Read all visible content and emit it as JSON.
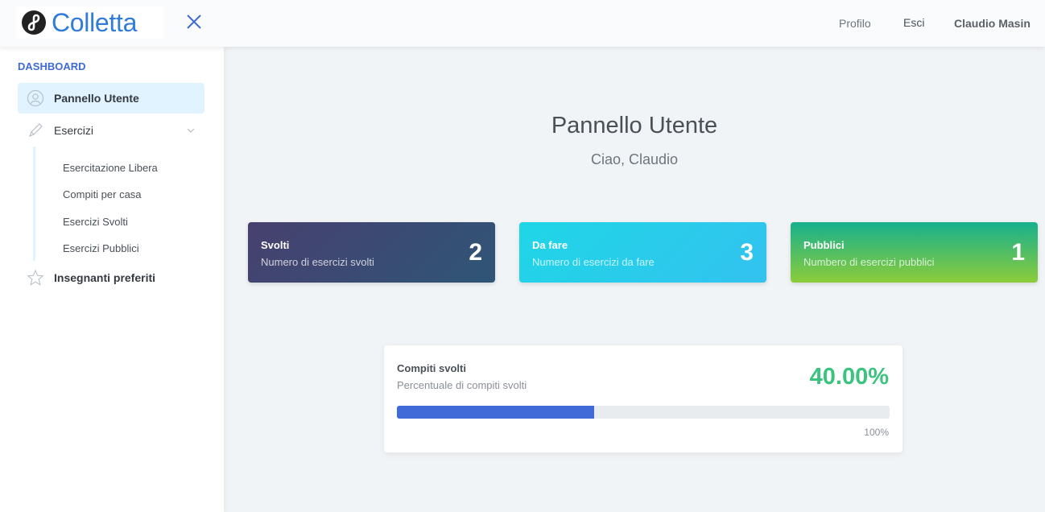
{
  "header": {
    "logo_text": "Colletta",
    "nav_profile": "Profilo",
    "nav_logout": "Esci",
    "user_name": "Claudio Masin"
  },
  "sidebar": {
    "heading": "DASHBOARD",
    "items": [
      {
        "label": "Pannello Utente",
        "icon": "user-circle-icon",
        "active": true
      },
      {
        "label": "Esercizi",
        "icon": "pencil-icon",
        "expanded": true
      },
      {
        "label": "Insegnanti preferiti",
        "icon": "star-icon"
      }
    ],
    "subitems": [
      {
        "label": "Esercitazione Libera"
      },
      {
        "label": "Compiti per casa"
      },
      {
        "label": "Esercizi Svolti"
      },
      {
        "label": "Esercizi Pubblici"
      }
    ]
  },
  "main": {
    "title": "Pannello Utente",
    "greeting": "Ciao, Claudio",
    "cards": [
      {
        "title": "Svolti",
        "subtitle": "Numero di esercizi svolti",
        "value": "2"
      },
      {
        "title": "Da fare",
        "subtitle": "Numero di esercizi da fare",
        "value": "3"
      },
      {
        "title": "Pubblici",
        "subtitle": "Numbero di esercizi pubblici",
        "value": "1"
      }
    ],
    "progress": {
      "title": "Compiti svolti",
      "subtitle": "Percentuale di compiti svolti",
      "percent_label": "40.00%",
      "percent": 40,
      "max_label": "100%"
    }
  },
  "colors": {
    "accent": "#3f6ad8",
    "success": "#3ac47d",
    "logo": "#2f7dd7"
  }
}
